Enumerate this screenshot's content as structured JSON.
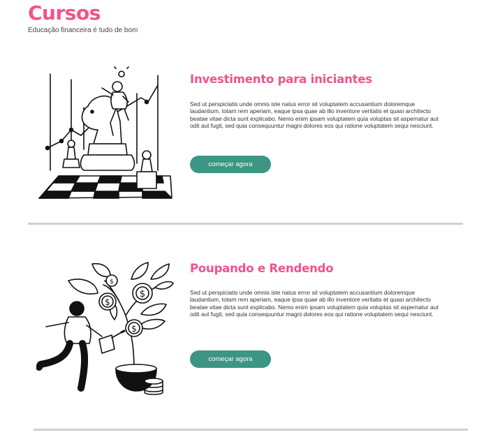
{
  "header": {
    "title": "Cursos",
    "subtitle": "Educação financeira é tudo de bom"
  },
  "courses": [
    {
      "title": "Investimento para iniciantes",
      "description": "Sed ut perspiciatis unde omnis iste natus error sit voluptatem accusantium doloremque laudantium, totam rem aperiam, eaque ipsa quae ab illo inventore veritatis et quasi architecto beatae vitae dicta sunt explicabo. Nemo enim ipsam voluptatem quia voluptas sit aspernatur aut odit aut fugit, sed quia consequuntur magni dolores eos qui ratione voluptatem sequi nesciunt.",
      "button_label": "começar agora",
      "illustration_icon": "chess-investment-illustration"
    },
    {
      "title": "Poupando e Rendendo",
      "description": "Sed ut perspiciatis unde omnis iste natus error sit voluptatem accusantium doloremque laudantium, totam rem aperiam, eaque ipsa quae ab illo inventore veritatis et quasi architecto beatae vitae dicta sunt explicabo. Nemo enim ipsam voluptatem quia voluptas sit aspernatur aut odit aut fugit, sed quia consequuntur magni dolores eos qui ratione voluptatem sequi nesciunt.",
      "button_label": "começar agora",
      "illustration_icon": "money-tree-illustration"
    }
  ],
  "colors": {
    "accent": "#f2528c",
    "button": "#3d9583",
    "divider": "#cfcfcf"
  }
}
